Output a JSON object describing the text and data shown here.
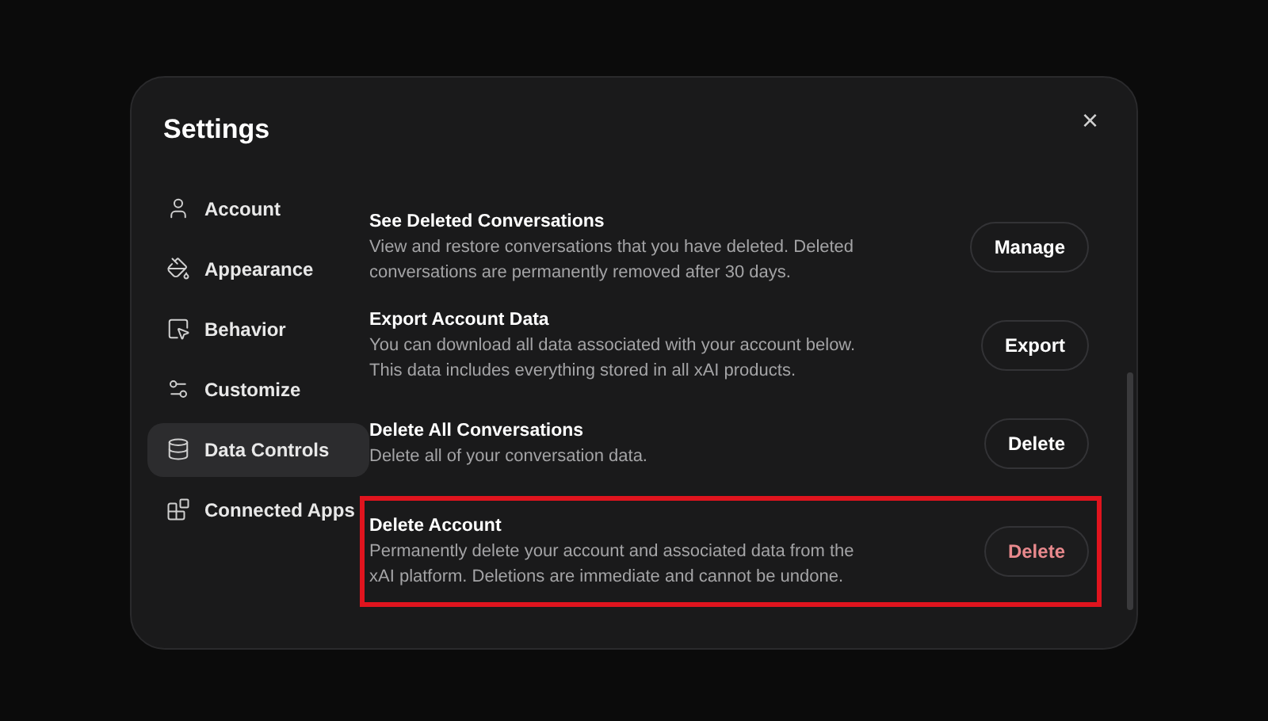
{
  "dialog": {
    "title": "Settings",
    "close": "×"
  },
  "sidebar": {
    "items": [
      {
        "label": "Account",
        "selected": false
      },
      {
        "label": "Appearance",
        "selected": false
      },
      {
        "label": "Behavior",
        "selected": false
      },
      {
        "label": "Customize",
        "selected": false
      },
      {
        "label": "Data Controls",
        "selected": true
      },
      {
        "label": "Connected Apps",
        "selected": false
      }
    ]
  },
  "settings": [
    {
      "title": "See Deleted Conversations",
      "description": "View and restore conversations that you have deleted. Deleted conversations are permanently removed after 30 days.",
      "button": "Manage",
      "danger": false,
      "highlighted": false
    },
    {
      "title": "Export Account Data",
      "description": "You can download all data associated with your account below. This data includes everything stored in all xAI products.",
      "button": "Export",
      "danger": false,
      "highlighted": false
    },
    {
      "title": "Delete All Conversations",
      "description": "Delete all of your conversation data.",
      "button": "Delete",
      "danger": false,
      "highlighted": false
    },
    {
      "title": "Delete Account",
      "description": "Permanently delete your account and associated data from the xAI platform. Deletions are immediate and cannot be undone.",
      "button": "Delete",
      "danger": true,
      "highlighted": true
    }
  ]
}
